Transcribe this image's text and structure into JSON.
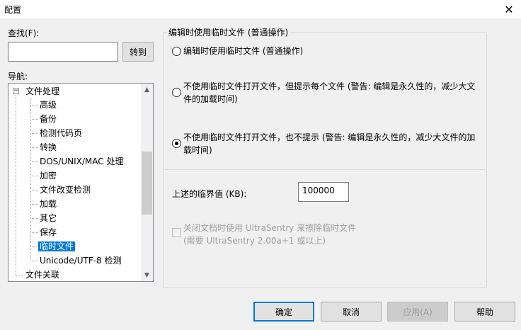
{
  "window": {
    "title": "配置",
    "close_glyph": "✕"
  },
  "search": {
    "label": "查找(F):",
    "value": "",
    "button": "转到"
  },
  "nav": {
    "label": "导航:",
    "tree": [
      {
        "label": "文件处理",
        "expander": "−"
      },
      {
        "label": "高级"
      },
      {
        "label": "备份"
      },
      {
        "label": "检测代码页"
      },
      {
        "label": "转换"
      },
      {
        "label": "DOS/UNIX/MAC 处理"
      },
      {
        "label": "加密"
      },
      {
        "label": "文件改变检测"
      },
      {
        "label": "加载"
      },
      {
        "label": "其它"
      },
      {
        "label": "保存"
      },
      {
        "label": "临时文件",
        "selected": true
      },
      {
        "label": "Unicode/UTF-8 检测"
      },
      {
        "label": "文件关联"
      }
    ],
    "scroll_up": "▲",
    "scroll_down": "▼"
  },
  "group": {
    "title": "编辑时使用临时文件 (普通操作)",
    "options": [
      {
        "line1": "编辑时使用临时文件 (普通操作)",
        "line2": "",
        "checked": false
      },
      {
        "line1": "不使用临时文件打开文件，但提示每个文件 (警告: 编辑是永久性的，减少大文",
        "line2": "件的加载时间)",
        "checked": false
      },
      {
        "line1": "不使用临时文件打开文件，也不提示 (警告: 编辑是永久性的，减少大文件的加",
        "line2": "载时间)",
        "checked": true
      }
    ],
    "threshold_label": "上述的临界值 (KB):",
    "threshold_value": "100000",
    "checkbox_line1": "关闭文档时使用 UltraSentry 来擦除临时文件",
    "checkbox_line2": "(需要 UltraSentry 2.00a+1 或以上)"
  },
  "buttons": {
    "ok": "确定",
    "cancel": "取消",
    "apply": "应用(A)",
    "help": "帮助"
  }
}
